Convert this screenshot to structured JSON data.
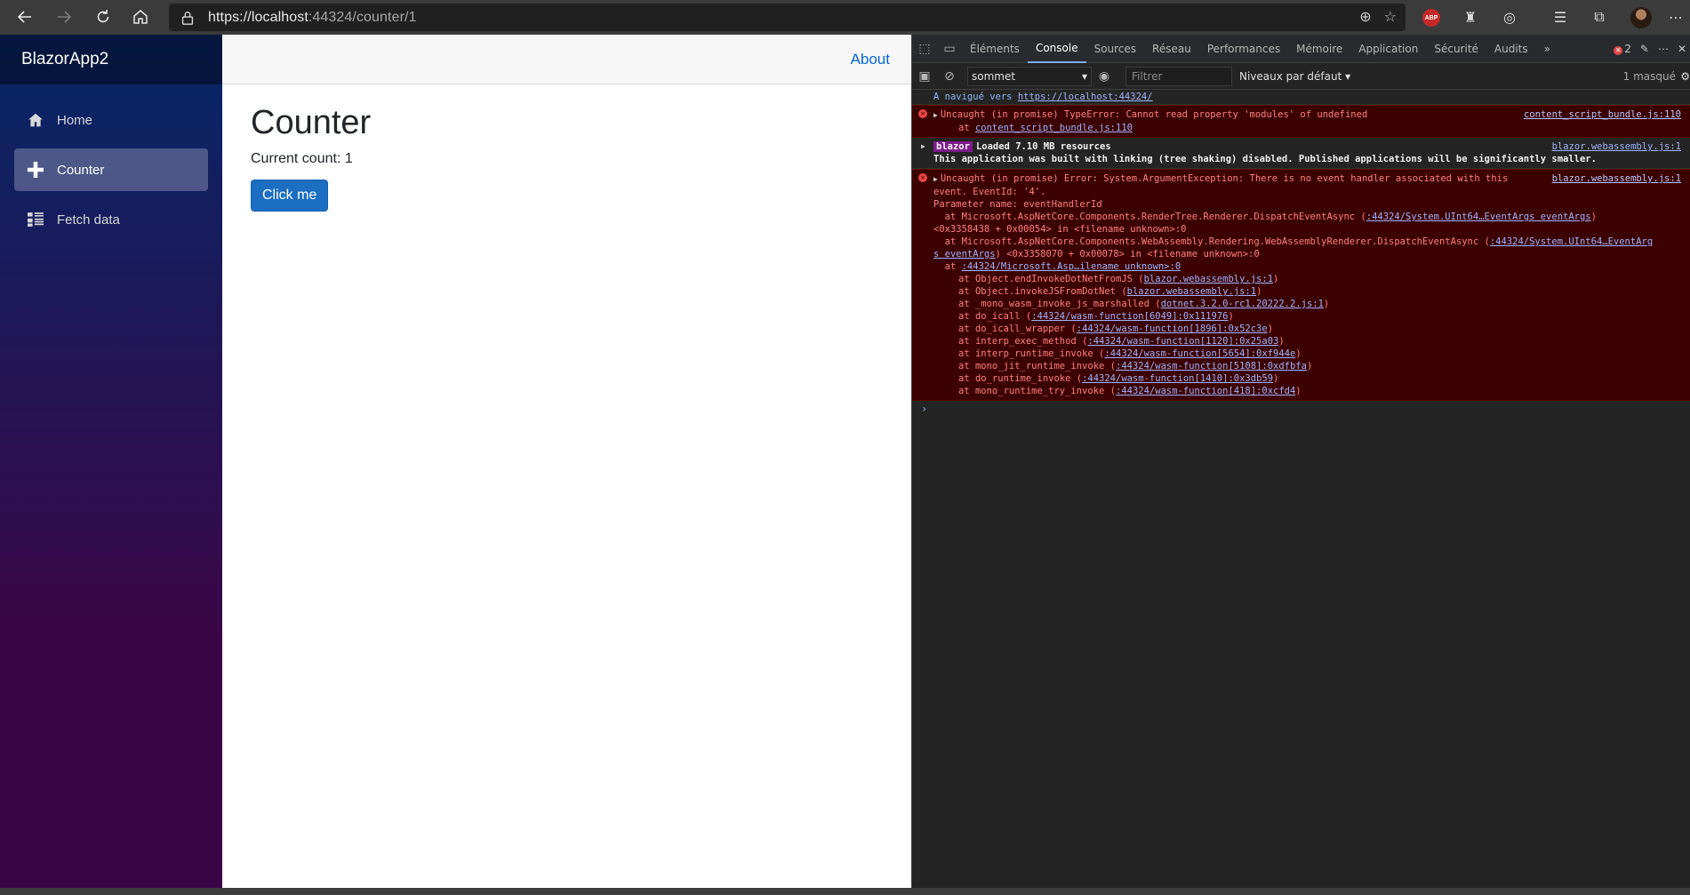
{
  "browser": {
    "url_host": "https://localhost",
    "url_rest": ":44324/counter/1",
    "abp_label": "ABP"
  },
  "app": {
    "brand": "BlazorApp2",
    "nav": [
      {
        "label": "Home",
        "icon": "home-icon"
      },
      {
        "label": "Counter",
        "icon": "plus-icon"
      },
      {
        "label": "Fetch data",
        "icon": "list-icon"
      }
    ],
    "about": "About",
    "title": "Counter",
    "count_text": "Current count: 1",
    "button": "Click me"
  },
  "devtools": {
    "tabs": [
      "Éléments",
      "Console",
      "Sources",
      "Réseau",
      "Performances",
      "Mémoire",
      "Application",
      "Sécurité",
      "Audits"
    ],
    "active_tab": "Console",
    "error_count": "2",
    "context": "sommet",
    "filter_placeholder": "Filtrer",
    "levels": "Niveaux par défaut",
    "hidden": "1 masqué",
    "nav_line": {
      "text": "A navigué vers ",
      "link": "https://localhost:44324/"
    },
    "error1": {
      "message": "Uncaught (in promise) TypeError: Cannot read property 'modules' of undefined",
      "at_prefix": "at ",
      "at_link": "content_script_bundle.js:110",
      "source": "content_script_bundle.js:110"
    },
    "info": {
      "tag": "blazor",
      "line1": "Loaded 7.10 MB resources",
      "line2": "This application was built with linking (tree shaking) disabled. Published applications will be significantly smaller.",
      "source": "blazor.webassembly.js:1"
    },
    "error2": {
      "message": "Uncaught (in promise) Error: System.ArgumentException: There is no event handler associated with this",
      "line2": "event. EventId: '4'.",
      "line3": "Parameter name: eventHandlerId",
      "source": "blazor.webassembly.js:1",
      "frame1_text": "  at Microsoft.AspNetCore.Components.RenderTree.Renderer.DispatchEventAsync (",
      "frame1_link": ":44324/System.UInt64…EventArgs eventArgs",
      "frame1_end": ")",
      "frame1_cont": "<0x3358438 + 0x00054> in <filename unknown>:0",
      "frame2_text": "  at Microsoft.AspNetCore.Components.WebAssembly.Rendering.WebAssemblyRenderer.DispatchEventAsync (",
      "frame2_link": ":44324/System.UInt64…EventArg",
      "frame2_cont_link": "s eventArgs",
      "frame2_cont": ") <0x3358070 + 0x00078> in <filename unknown>:0",
      "frame3_text": "  at ",
      "frame3_link": ":44324/Microsoft.Asp…ilename unknown>:0",
      "stack": [
        {
          "fn": "at Object.endInvokeDotNetFromJS (",
          "link": "blazor.webassembly.js:1"
        },
        {
          "fn": "at Object.invokeJSFromDotNet (",
          "link": "blazor.webassembly.js:1"
        },
        {
          "fn": "at _mono_wasm_invoke_js_marshalled (",
          "link": "dotnet.3.2.0-rc1.20222.2.js:1"
        },
        {
          "fn": "at do_icall (",
          "link": ":44324/wasm-function[6049]:0x111976"
        },
        {
          "fn": "at do_icall_wrapper (",
          "link": ":44324/wasm-function[1896]:0x52c3e"
        },
        {
          "fn": "at interp_exec_method (",
          "link": ":44324/wasm-function[1120]:0x25a03"
        },
        {
          "fn": "at interp_runtime_invoke (",
          "link": ":44324/wasm-function[5654]:0xf944e"
        },
        {
          "fn": "at mono_jit_runtime_invoke (",
          "link": ":44324/wasm-function[5108]:0xdfbfa"
        },
        {
          "fn": "at do_runtime_invoke (",
          "link": ":44324/wasm-function[1410]:0x3db59"
        },
        {
          "fn": "at mono_runtime_try_invoke (",
          "link": ":44324/wasm-function[418]:0xcfd4"
        }
      ]
    }
  }
}
